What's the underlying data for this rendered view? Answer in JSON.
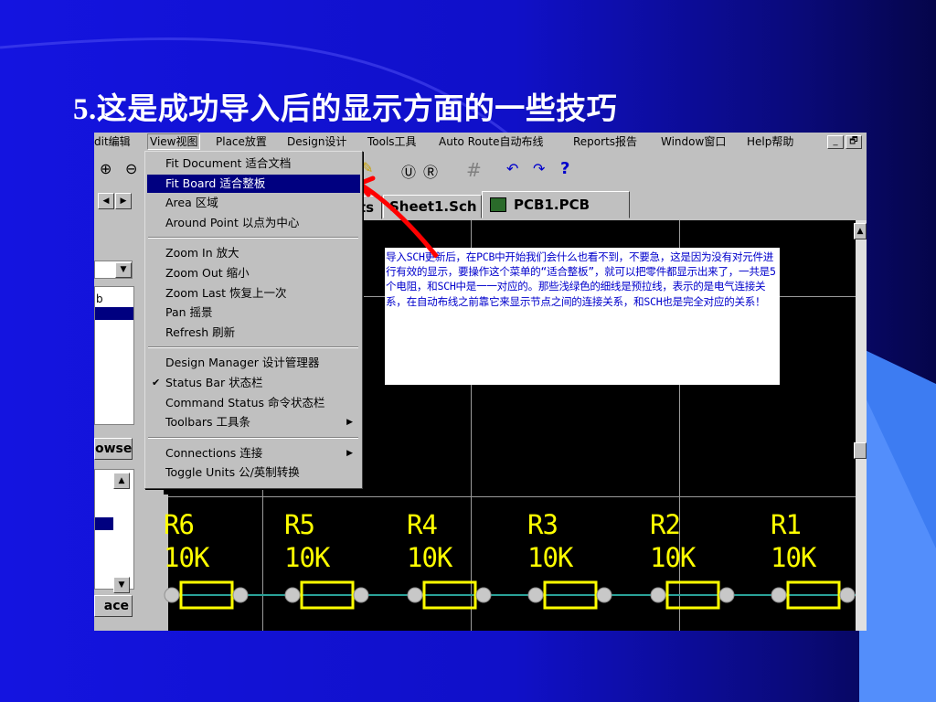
{
  "slide": {
    "title": "5.这是成功导入后的显示方面的一些技巧"
  },
  "menubar": {
    "items": [
      "dit编辑",
      "View视图",
      "Place放置",
      "Design设计",
      "Tools工具",
      "Auto Route自动布线",
      "Reports报告",
      "Window窗口",
      "Help帮助"
    ],
    "window_buttons": [
      "_",
      "🗗"
    ]
  },
  "toolbar": {
    "icons": [
      "zoom-in-icon",
      "zoom-out-icon",
      "pencil-icon",
      "component-icon",
      "component-alt-icon",
      "grid-icon",
      "undo-icon",
      "redo-icon",
      "help-icon"
    ],
    "glyphs": {
      "zoom_in": "⊕",
      "zoom_out": "⊖",
      "pencil": "✎",
      "comp1": "Ⓤ",
      "comp2": "Ⓡ",
      "grid": "#",
      "undo": "↶",
      "redo": "↷",
      "help": "?"
    }
  },
  "tabs": {
    "partial": "ts",
    "sheet": "Sheet1.Sch",
    "pcb": "PCB1.PCB"
  },
  "left_panel": {
    "list_item": "b",
    "browse_button": "owse",
    "place_button": "ace"
  },
  "view_menu": {
    "groups": [
      [
        {
          "label": "Fit Document 适合文档"
        },
        {
          "label": "Fit Board 适合整板",
          "highlighted": true
        },
        {
          "label": "Area 区域"
        },
        {
          "label": "Around Point 以点为中心"
        }
      ],
      [
        {
          "label": "Zoom In 放大"
        },
        {
          "label": "Zoom Out  缩小"
        },
        {
          "label": "Zoom Last 恢复上一次"
        },
        {
          "label": "Pan 摇景"
        },
        {
          "label": "Refresh  刷新"
        }
      ],
      [
        {
          "label": "Design Manager 设计管理器"
        },
        {
          "label": "Status Bar 状态栏",
          "checked": true
        },
        {
          "label": "Command Status 命令状态栏"
        },
        {
          "label": "Toolbars 工具条",
          "submenu": true
        }
      ],
      [
        {
          "label": "Connections 连接",
          "submenu": true
        },
        {
          "label": "Toggle Units 公/英制转换"
        }
      ]
    ]
  },
  "annotation": {
    "text": "导入SCH更新后，在PCB中开始我们会什么也看不到，不要急，这是因为没有对元件进行有效的显示，要操作这个菜单的“适合整板”，就可以把零件都显示出来了，一共是5个电阻，和SCH中是一一对应的。那些浅绿色的细线是预拉线，表示的是电气连接关系，在自动布线之前靠它来显示节点之间的连接关系，和SCH也是完全对应的关系！"
  },
  "resistors": [
    {
      "designator": "R6",
      "value": "10K"
    },
    {
      "designator": "R5",
      "value": "10K"
    },
    {
      "designator": "R4",
      "value": "10K"
    },
    {
      "designator": "R3",
      "value": "10K"
    },
    {
      "designator": "R2",
      "value": "10K"
    },
    {
      "designator": "R1",
      "value": "10K"
    }
  ],
  "colors": {
    "background": "#1414e0",
    "canvas": "#000000",
    "designator": "#ffff00",
    "outline": "#ffff00",
    "pad": "#c8c8c8",
    "ratsnest": "#2aa198",
    "arrow": "#ff0000",
    "note_text": "#0000cc",
    "menu_highlight": "#000080"
  }
}
